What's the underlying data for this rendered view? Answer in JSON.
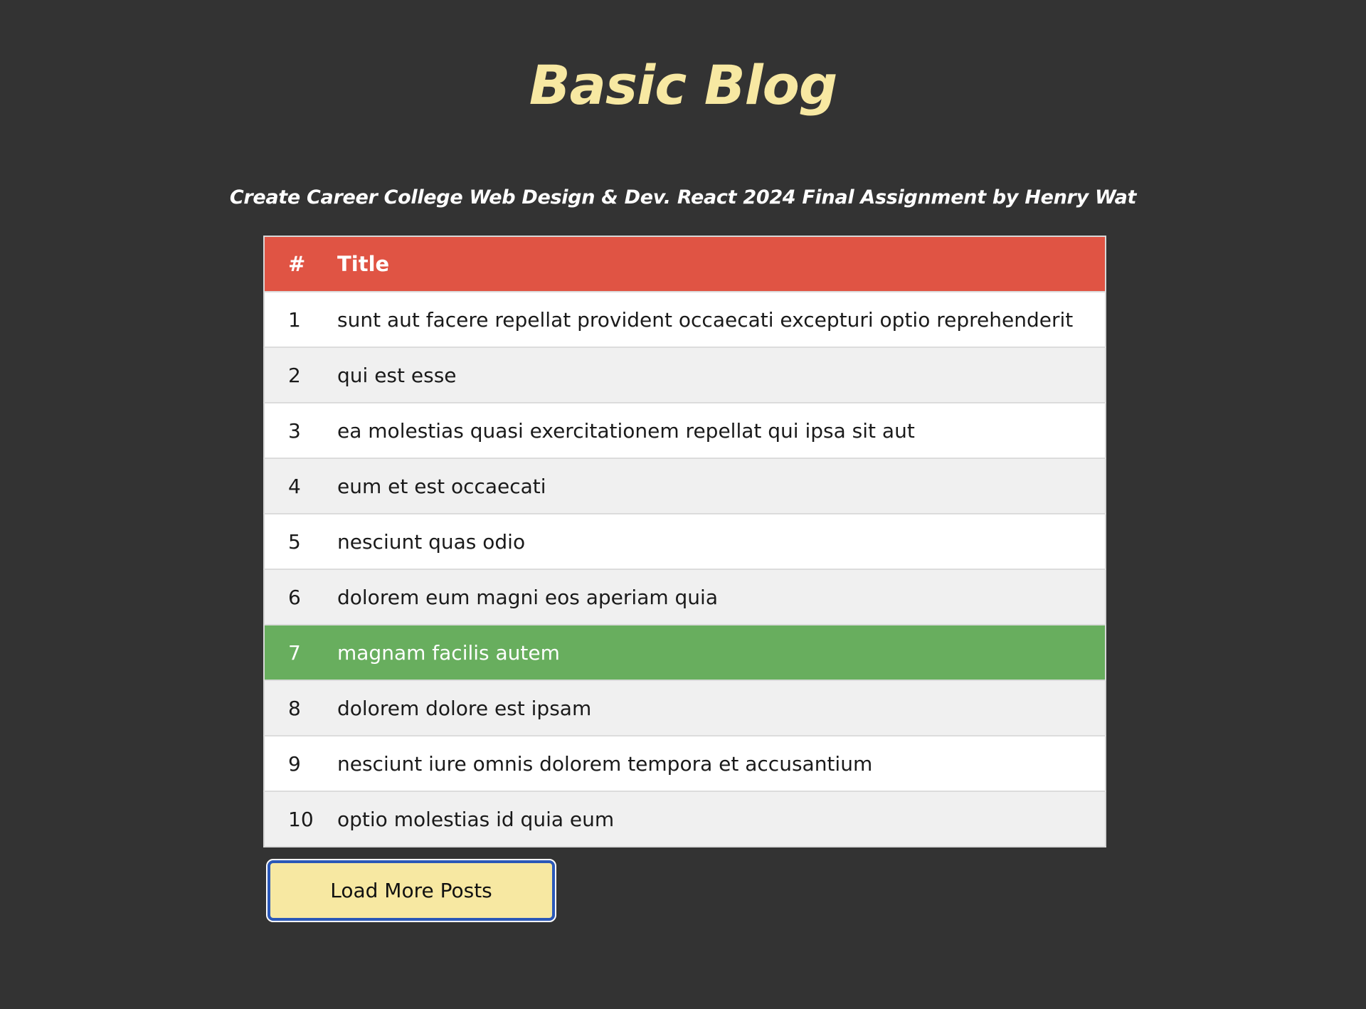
{
  "header": {
    "title": "Basic Blog",
    "subtitle": "Create Career College Web Design & Dev. React 2024 Final Assignment by Henry Wat"
  },
  "table": {
    "columns": [
      "#",
      "Title"
    ],
    "rows": [
      {
        "id": "1",
        "title": "sunt aut facere repellat provident occaecati excepturi optio reprehenderit"
      },
      {
        "id": "2",
        "title": "qui est esse"
      },
      {
        "id": "3",
        "title": "ea molestias quasi exercitationem repellat qui ipsa sit aut"
      },
      {
        "id": "4",
        "title": "eum et est occaecati"
      },
      {
        "id": "5",
        "title": "nesciunt quas odio"
      },
      {
        "id": "6",
        "title": "dolorem eum magni eos aperiam quia"
      },
      {
        "id": "7",
        "title": "magnam facilis autem"
      },
      {
        "id": "8",
        "title": "dolorem dolore est ipsam"
      },
      {
        "id": "9",
        "title": "nesciunt iure omnis dolorem tempora et accusantium"
      },
      {
        "id": "10",
        "title": "optio molestias id quia eum"
      }
    ],
    "selected_row": 7
  },
  "actions": {
    "load_more_label": "Load More Posts"
  },
  "colors": {
    "background": "#333333",
    "title": "#f7e8a2",
    "header_row": "#e05444",
    "selected_row": "#68ae5e",
    "button": "#f7e8a2",
    "button_border": "#2b58b8"
  }
}
